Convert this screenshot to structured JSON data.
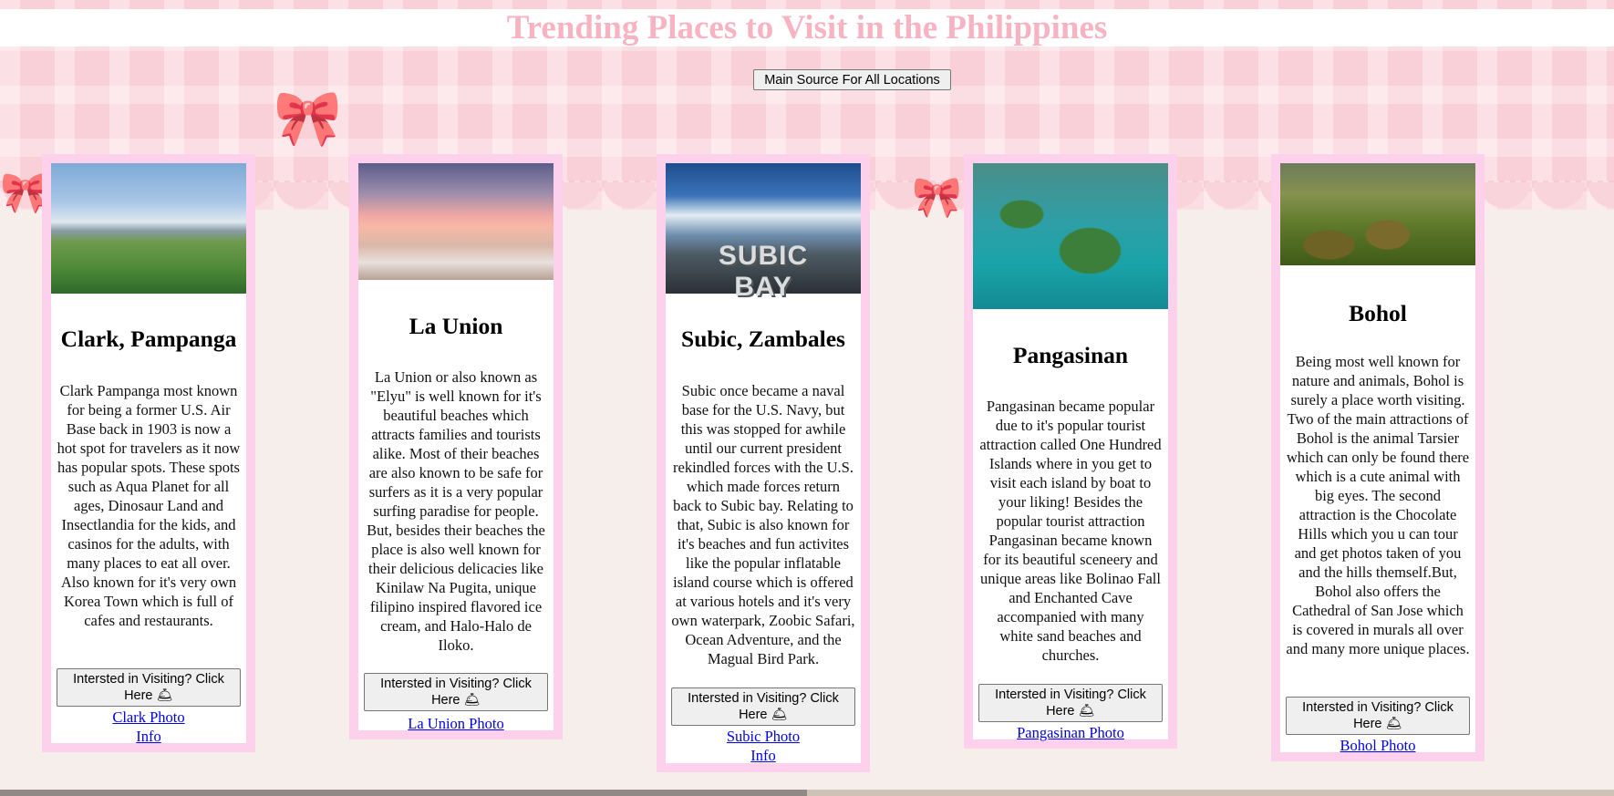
{
  "page": {
    "title": "Trending Places to Visit in the Philippines",
    "main_source_label": "Main Source For All Locations"
  },
  "colors": {
    "title": "#f7b3c2",
    "card_border": "#fdd0eb",
    "link": "#0000ee"
  },
  "cards": [
    {
      "name": "Clark, Pampanga",
      "description": "Clark Pampanga most known for being a former U.S. Air Base back in 1903 is now a hot spot for travelers as it now has popular spots. These spots such as Aqua Planet for all ages, Dinosaur Land and Insectlandia for the kids, and casinos for the adults, with many places to eat all over. Also known for it's very own Korea Town which is full of cafes and restaurants.",
      "button": "Intersted in Visiting? Click Here 🛎",
      "photo_link": "Clark Photo",
      "info_link": "Info"
    },
    {
      "name": "La Union",
      "description": "La Union or also known as \"Elyu\" is well known for it's beautiful beaches which attracts families and tourists alike. Most of their beaches are also known to be safe for surfers as it is a very popular surfing paradise for people. But, besides their beaches the place is also well known for their delicious delicacies like Kinilaw Na Pugita, unique filipino inspired flavored ice cream, and Halo-Halo de Iloko.",
      "button": "Intersted in Visiting? Click Here 🛎",
      "photo_link": "La Union Photo"
    },
    {
      "name": "Subic, Zambales",
      "photo_caption": "SUBIC BAY",
      "description": "Subic once became a naval base for the U.S. Navy, but this was stopped for awhile until our current president rekindled forces with the U.S. which made forces return back to Subic bay. Relating to that, Subic is also known for it's beaches and fun activites like the popular inflatable island course which is offered at various hotels and it's very own waterpark, Zoobic Safari, Ocean Adventure, and the Magual Bird Park.",
      "button": "Intersted in Visiting? Click Here 🛎",
      "photo_link": "Subic Photo",
      "info_link": "Info"
    },
    {
      "name": "Pangasinan",
      "description": "Pangasinan became popular due to it's popular tourist attraction called One Hundred Islands where in you get to visit each island by boat to your liking! Besides the popular tourist attraction Pangasinan became known for its beautiful sceneery and unique areas like Bolinao Fall and Enchanted Cave accompanied with many white sand beaches and churches.",
      "button": "Intersted in Visiting? Click Here 🛎",
      "photo_link": "Pangasinan Photo"
    },
    {
      "name": "Bohol",
      "description": "Being most well known for nature and animals, Bohol is surely a place worth visiting. Two of the main attractions of Bohol is the animal Tarsier which can only be found there which is a cute animal with big eyes. The second attraction is the Chocolate Hills which you u can tour and get photos taken of you and the hills themself.But, Bohol also offers the Cathedral of San Jose which is covered in murals all over and many more unique places.",
      "button": "Intersted in Visiting? Click Here 🛎",
      "photo_link": "Bohol Photo"
    }
  ]
}
